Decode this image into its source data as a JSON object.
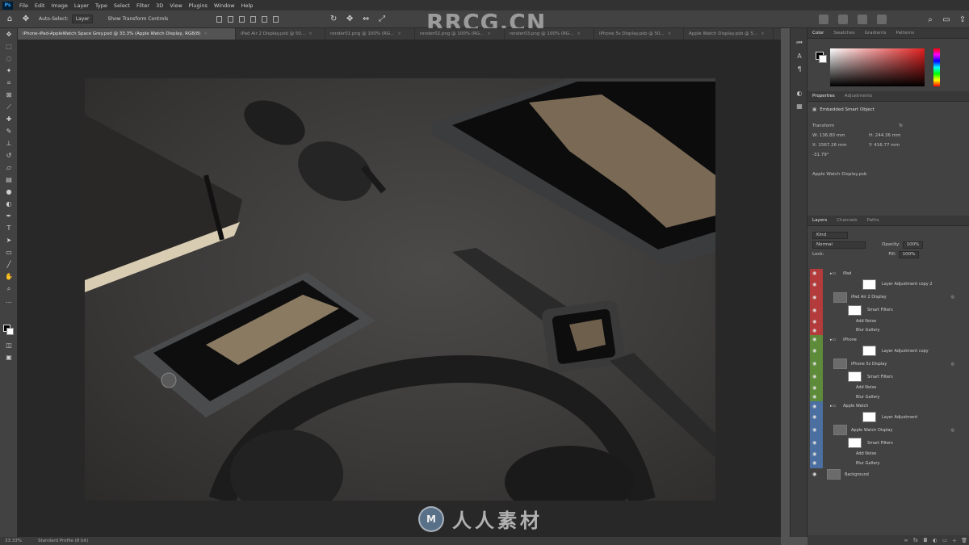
{
  "menubar": {
    "logo": "Ps",
    "items": [
      "File",
      "Edit",
      "Image",
      "Layer",
      "Type",
      "Select",
      "Filter",
      "3D",
      "View",
      "Plugins",
      "Window",
      "Help"
    ]
  },
  "options": {
    "auto_select_label": "Auto-Select:",
    "auto_select_value": "Layer",
    "show_transform_label": "Show Transform Controls"
  },
  "watermark": {
    "top": "RRCG.CN",
    "bottom": "人人素材"
  },
  "tabs": [
    {
      "label": "iPhone-iPad-AppleWatch Space Grey.psd @ 33.3% (Apple Watch Display, RGB/8)",
      "active": true
    },
    {
      "label": "iPad Air 2 Display.psb @ 50...",
      "active": false
    },
    {
      "label": "render01.png @ 100% (RG...",
      "active": false
    },
    {
      "label": "render02.png @ 100% (RG...",
      "active": false
    },
    {
      "label": "render03.png @ 100% (RG...",
      "active": false
    },
    {
      "label": "iPhone 5s Display.psb @ 50...",
      "active": false
    },
    {
      "label": "Apple Watch Display.psb @ 5...",
      "active": false
    }
  ],
  "status": {
    "zoom": "33.33%",
    "info": "Standard Profile (8 bit)"
  },
  "color_panel": {
    "tabs": [
      "Color",
      "Swatches",
      "Gradients",
      "Patterns"
    ]
  },
  "properties_panel": {
    "tabs": [
      "Properties",
      "Adjustments"
    ],
    "title": "Embedded Smart Object",
    "section": "Transform",
    "w": "W: 136.80 mm",
    "h": "H: 244.36 mm",
    "x": "X: 1567.26 mm",
    "y": "Y: 416.77 mm",
    "angle": "-31.79°",
    "file": "Apple Watch Display.psb"
  },
  "layers_panel": {
    "tabs": [
      "Layers",
      "Channels",
      "Paths"
    ],
    "kind_label": "Kind",
    "blend_mode": "Normal",
    "opacity_label": "Opacity:",
    "opacity": "100%",
    "lock_label": "Lock:",
    "fill_label": "Fill:",
    "fill": "100%",
    "layers": [
      {
        "name": "iPad",
        "type": "group",
        "color": "#b33b3b"
      },
      {
        "name": "Layer Adjustment copy 2",
        "type": "adj",
        "color": "#b33b3b"
      },
      {
        "name": "iPad Air 2 Display",
        "type": "smart",
        "color": "#b33b3b"
      },
      {
        "name": "Smart Filters",
        "type": "filters",
        "color": "#b33b3b"
      },
      {
        "name": "Add Noise",
        "type": "filter",
        "color": "#b33b3b"
      },
      {
        "name": "Blur Gallery",
        "type": "filter",
        "color": "#b33b3b"
      },
      {
        "name": "iPhone",
        "type": "group",
        "color": "#5d8b3a"
      },
      {
        "name": "Layer Adjustment copy",
        "type": "adj",
        "color": "#5d8b3a"
      },
      {
        "name": "iPhone 5s Display",
        "type": "smart",
        "color": "#5d8b3a"
      },
      {
        "name": "Smart Filters",
        "type": "filters",
        "color": "#5d8b3a"
      },
      {
        "name": "Add Noise",
        "type": "filter",
        "color": "#5d8b3a"
      },
      {
        "name": "Blur Gallery",
        "type": "filter",
        "color": "#5d8b3a"
      },
      {
        "name": "Apple Watch",
        "type": "group",
        "color": "#4a6fa0"
      },
      {
        "name": "Layer Adjustment",
        "type": "adj",
        "color": "#4a6fa0"
      },
      {
        "name": "Apple Watch Display",
        "type": "smart",
        "color": "#4a6fa0"
      },
      {
        "name": "Smart Filters",
        "type": "filters",
        "color": "#4a6fa0"
      },
      {
        "name": "Add Noise",
        "type": "filter",
        "color": "#4a6fa0"
      },
      {
        "name": "Blur Gallery",
        "type": "filter",
        "color": "#4a6fa0"
      },
      {
        "name": "Background",
        "type": "bg",
        "color": ""
      }
    ]
  }
}
